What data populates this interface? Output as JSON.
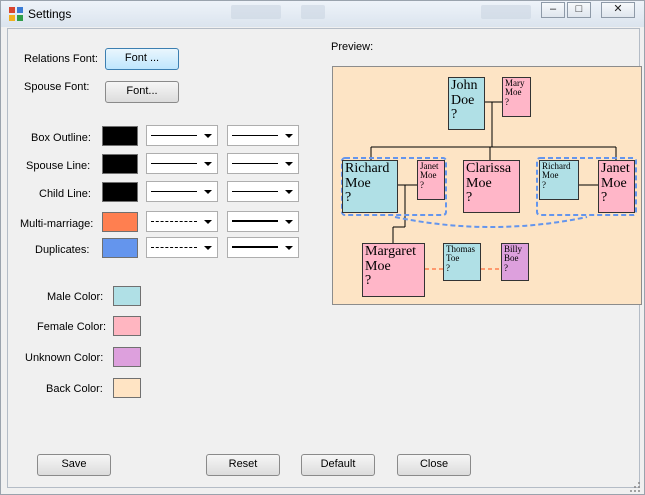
{
  "window": {
    "title": "Settings"
  },
  "fonts": {
    "relations_label": "Relations Font:",
    "relations_button": "Font ...",
    "spouse_label": "Spouse Font:",
    "spouse_button": "Font..."
  },
  "lines": [
    {
      "label": "Box Outline:",
      "color": "#000000",
      "style1": "solid",
      "style2": "solid"
    },
    {
      "label": "Spouse Line:",
      "color": "#000000",
      "style1": "solid",
      "style2": "solid"
    },
    {
      "label": "Child Line:",
      "color": "#000000",
      "style1": "solid",
      "style2": "solid"
    },
    {
      "label": "Multi-marriage:",
      "color": "#ff7f50",
      "style1": "dashed",
      "style2": "thick"
    },
    {
      "label": "Duplicates:",
      "color": "#6495ed",
      "style1": "dashed",
      "style2": "thick"
    }
  ],
  "colors": [
    {
      "label": "Male Color:",
      "color": "#b0e0e6"
    },
    {
      "label": "Female Color:",
      "color": "#ffb6c1"
    },
    {
      "label": "Unknown Color:",
      "color": "#dda0dd"
    },
    {
      "label": "Back Color:",
      "color": "#ffe4c4"
    }
  ],
  "preview": {
    "label": "Preview:",
    "nodes": {
      "john": {
        "first": "John",
        "last": "Doe",
        "q": "?"
      },
      "mary": {
        "first": "Mary",
        "last": "Moe",
        "q": "?"
      },
      "richard": {
        "first": "Richard",
        "last": "Moe",
        "q": "?"
      },
      "janet_small": {
        "first": "Janet",
        "last": "Moe",
        "q": "?"
      },
      "clarissa": {
        "first": "Clarissa",
        "last": "Moe",
        "q": "?"
      },
      "richard_small": {
        "first": "Richard",
        "last": "Moe",
        "q": "?"
      },
      "janet": {
        "first": "Janet",
        "last": "Moe",
        "q": "?"
      },
      "margaret": {
        "first": "Margaret",
        "last": "Moe",
        "q": "?"
      },
      "thomas": {
        "first": "Thomas",
        "last": "Toe",
        "q": "?"
      },
      "billy": {
        "first": "Billy",
        "last": "Boe",
        "q": "?"
      }
    }
  },
  "buttons": {
    "save": "Save",
    "reset": "Reset",
    "default": "Default",
    "close": "Close"
  }
}
